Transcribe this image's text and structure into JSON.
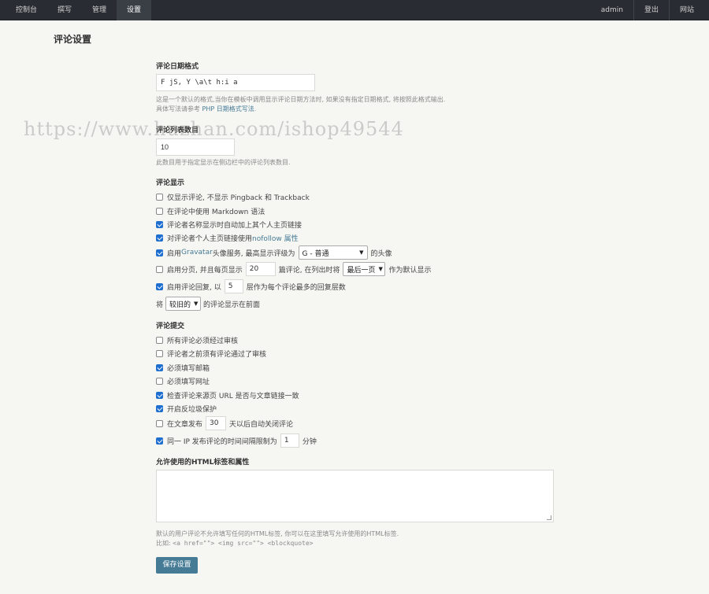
{
  "nav": {
    "left": [
      "控制台",
      "撰写",
      "管理",
      "设置"
    ],
    "right": [
      "admin",
      "登出",
      "网站"
    ],
    "active_index": 3
  },
  "page_title": "评论设置",
  "date_format": {
    "label": "评论日期格式",
    "value": "F jS, Y \\a\\t h:i a",
    "desc_line1": "这是一个默认的格式,当你在模板中调用显示评论日期方法时, 如果没有指定日期格式, 将按照此格式输出.",
    "desc_line2_prefix": "具体写法请参考 ",
    "desc_line2_link": "PHP 日期格式写法",
    "desc_line2_suffix": "."
  },
  "list_size": {
    "label": "评论列表数目",
    "value": "10",
    "desc": "此数目用于指定显示在侧边栏中的评论列表数目."
  },
  "display": {
    "label": "评论显示",
    "opt1": "仅显示评论, 不显示 Pingback 和 Trackback",
    "opt2": "在评论中使用 Markdown 语法",
    "opt3": "评论者名称显示时自动加上其个人主页链接",
    "opt4_prefix": "对评论者个人主页链接使用 ",
    "opt4_link": "nofollow 属性",
    "opt5_prefix": "启用 ",
    "opt5_link": "Gravatar",
    "opt5_mid": " 头像服务, 最高显示评级为",
    "opt5_select": "G - 普通",
    "opt5_suffix": "的头像",
    "opt6_prefix": "启用分页, 并且每页显示",
    "opt6_value": "20",
    "opt6_mid": "篇评论, 在列出时将",
    "opt6_select": "最后一页",
    "opt6_suffix": "作为默认显示",
    "opt7_prefix": "启用评论回复, 以",
    "opt7_value": "5",
    "opt7_suffix": "层作为每个评论最多的回复层数",
    "order_prefix": "将",
    "order_select": "较旧的",
    "order_suffix": "的评论显示在前面"
  },
  "submit": {
    "label": "评论提交",
    "opt1": "所有评论必须经过审核",
    "opt2": "评论者之前须有评论通过了审核",
    "opt3": "必须填写邮箱",
    "opt4": "必须填写网址",
    "opt5": "检查评论来源页 URL 是否与文章链接一致",
    "opt6": "开启反垃圾保护",
    "opt7_prefix": "在文章发布",
    "opt7_value": "30",
    "opt7_suffix": "天以后自动关闭评论",
    "opt8_prefix": "同一 IP 发布评论的时间间隔限制为",
    "opt8_value": "1",
    "opt8_suffix": "分钟"
  },
  "html_tags": {
    "label": "允许使用的HTML标签和属性",
    "value": "",
    "desc_line1": "默认的用户评论不允许填写任何的HTML标签, 你可以在这里填写允许使用的HTML标签.",
    "desc_line2_prefix": "比如: ",
    "desc_line2_code": "<a href=\"\"> <img src=\"\"> <blockquote>"
  },
  "save_label": "保存设置",
  "watermark": "https://www.huzhan.com/ishop49544",
  "colors": {
    "topbar": "#292d33",
    "link": "#467b96",
    "checkbox": "#1f6fd1",
    "background": "#f6f6f3"
  }
}
